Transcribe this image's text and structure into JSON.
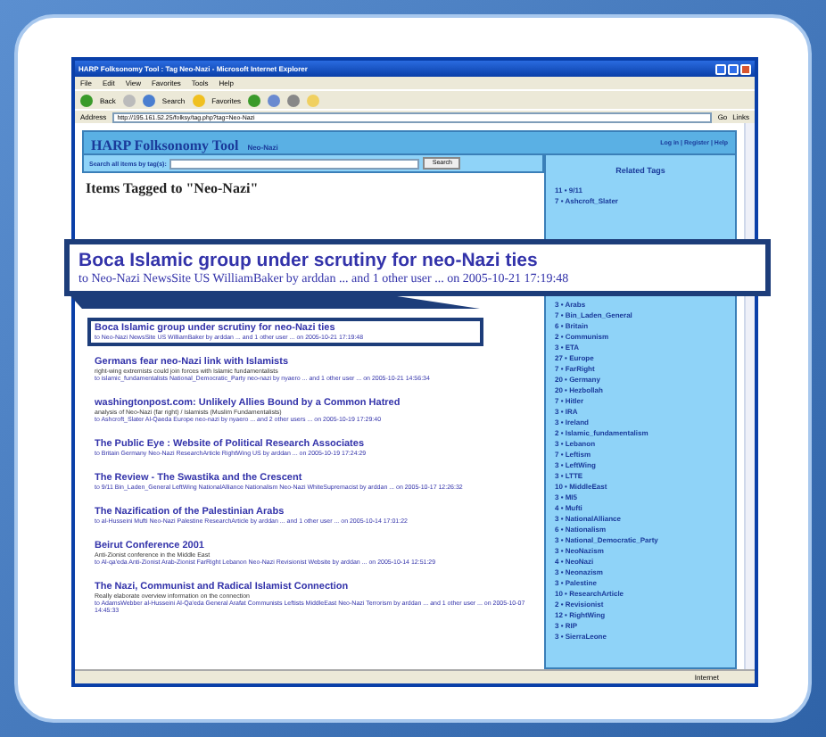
{
  "window": {
    "title": "HARP Folksonomy Tool : Tag Neo-Nazi - Microsoft Internet Explorer"
  },
  "menu": [
    "File",
    "Edit",
    "View",
    "Favorites",
    "Tools",
    "Help"
  ],
  "toolbar": {
    "back": "Back",
    "search": "Search",
    "favorites": "Favorites"
  },
  "address": {
    "label": "Address",
    "value": "http://195.161.52.25/folksy/tag.php?tag=Neo-Nazi",
    "go": "Go",
    "links": "Links"
  },
  "header": {
    "title": "HARP Folksonomy Tool",
    "tag": "Neo-Nazi",
    "links": "Log in | Register | Help"
  },
  "search": {
    "label": "Search all items by tag(s):",
    "button": "Search"
  },
  "heading": "Items Tagged to \"Neo-Nazi\"",
  "items": [
    {
      "title": "Boca Islamic group under scrutiny for neo-Nazi ties",
      "meta": "to Neo-Nazi NewsSite US WilliamBaker by arddan ... and 1 other user ... on 2005-10-21 17:19:48",
      "highlighted": true
    },
    {
      "title": "Germans fear neo-Nazi link with Islamists",
      "desc": "right-wing extremists could join forces with Islamic fundamentalists",
      "meta": "to islamic_fundamentalists National_Democratic_Party neo-nazi by nyaero ... and 1 other user ... on 2005-10-21 14:56:34",
      "highlighted": false
    },
    {
      "title": "washingtonpost.com: Unlikely Allies Bound by a Common Hatred",
      "desc": "analysis of Neo-Nazi (far right) / Islamists (Muslim Fundamentalists)",
      "meta": "to Ashcroft_Slater Al-Qaeda Europe neo-nazi by nyaero ... and 2 other users ... on 2005-10-19 17:29:40",
      "highlighted": false
    },
    {
      "title": "The Public Eye : Website of Political Research Associates",
      "meta": "to Britain Germany Neo-Nazi ResearchArticle RightWing US by arddan ... on 2005-10-19 17:24:29",
      "highlighted": false
    },
    {
      "title": "The Review - The Swastika and the Crescent",
      "meta": "to 9/11 Bin_Laden_General LeftWing NationalAlliance Nationalism Neo-Nazi WhiteSupremacist by arddan ... on 2005-10-17 12:26:32",
      "highlighted": false
    },
    {
      "title": "The Nazification of the Palestinian Arabs",
      "meta": "to al-Husseini Mufti Neo-Nazi Palestine ResearchArticle by arddan ... and 1 other user ... on 2005-10-14 17:01:22",
      "highlighted": false
    },
    {
      "title": "Beirut Conference 2001",
      "desc": "Anti-Zionist conference in the Middle East",
      "meta": "to Al-qa'eda Anti-Zionist Arab-Zionist FarRight Lebanon Neo-Nazi Revisionist Website by arddan ... on 2005-10-14 12:51:29",
      "highlighted": false
    },
    {
      "title": "The Nazi, Communist and Radical Islamist Connection",
      "desc": "Really elaborate overview information on the connection",
      "meta": "to AdamsWebber al-Husseini Al-Qa'eda General Arafat Communists Leftists MiddleEast Neo-Nazi Terrorism by arddan ... and 1 other user ... on 2005-10-07 14:45:33",
      "highlighted": false
    }
  ],
  "related": {
    "title": "Related Tags",
    "top": [
      "11 • 9/11",
      "7 • Ashcroft_Slater"
    ],
    "rest": [
      "3 • Arabs",
      "7 • Bin_Laden_General",
      "6 • Britain",
      "2 • Communism",
      "3 • ETA",
      "27 • Europe",
      "7 • FarRight",
      "20 • Germany",
      "20 • Hezbollah",
      "7 • Hitler",
      "3 • IRA",
      "3 • Ireland",
      "2 • Islamic_fundamentalism",
      "3 • Lebanon",
      "7 • Leftism",
      "3 • LeftWing",
      "3 • LTTE",
      "10 • MiddleEast",
      "3 • MI5",
      "4 • Mufti",
      "3 • NationalAlliance",
      "6 • Nationalism",
      "3 • National_Democratic_Party",
      "3 • NeoNazism",
      "4 • NeoNazi",
      "3 • Neonazism",
      "3 • Palestine",
      "10 • ResearchArticle",
      "2 • Revisionist",
      "12 • RightWing",
      "3 • RIP",
      "3 • SierraLeone"
    ]
  },
  "status": {
    "zone": "Internet"
  },
  "callout": {
    "title": "Boca Islamic group under scrutiny for neo-Nazi ties",
    "meta": "to Neo-Nazi NewsSite US WilliamBaker by arddan ... and 1 other user ... on 2005-10-21 17:19:48"
  }
}
